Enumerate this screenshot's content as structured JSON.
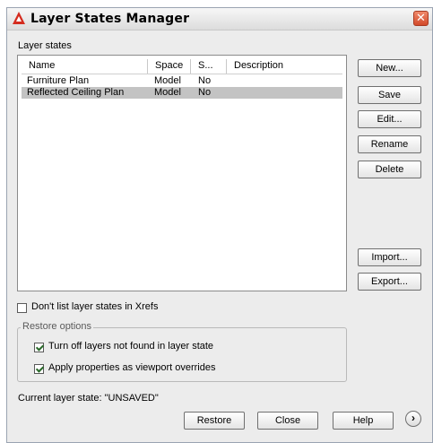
{
  "window": {
    "title": "Layer States Manager",
    "close_label": "✕"
  },
  "layer_states": {
    "label": "Layer states",
    "columns": [
      "Name",
      "Space",
      "S...",
      "Description"
    ],
    "rows": [
      {
        "name": "Furniture Plan",
        "space": "Model",
        "saved": "No",
        "description": "",
        "selected": false
      },
      {
        "name": "Reflected Ceiling Plan",
        "space": "Model",
        "saved": "No",
        "description": "",
        "selected": true
      }
    ]
  },
  "side_buttons": {
    "new": "New...",
    "save": "Save",
    "edit": "Edit...",
    "rename": "Rename",
    "delete": "Delete",
    "import": "Import...",
    "export": "Export..."
  },
  "xrefs_checkbox": {
    "label": "Don't list layer states in Xrefs",
    "checked": false
  },
  "restore_options": {
    "title": "Restore options",
    "turn_off": {
      "label": "Turn off layers not found in layer state",
      "checked": true
    },
    "apply_props": {
      "label": "Apply properties as viewport overrides",
      "checked": true
    }
  },
  "current_state": "Current layer state: \"UNSAVED\"",
  "bottom_buttons": {
    "restore": "Restore",
    "close": "Close",
    "help": "Help",
    "more": "›"
  },
  "icons": {
    "app_icon": "autocad-a-icon",
    "accent": "#d42b1e"
  }
}
